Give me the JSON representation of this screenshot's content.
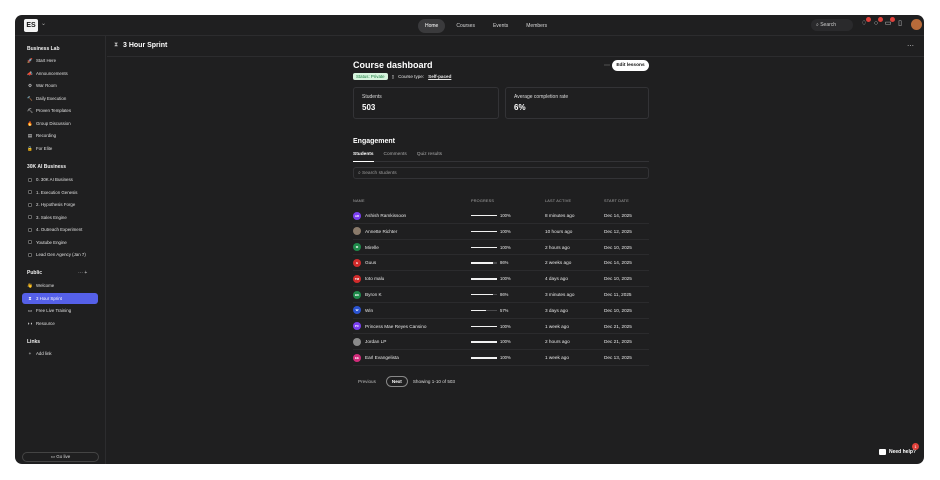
{
  "topbar": {
    "logo": "ES",
    "nav": [
      "Home",
      "Courses",
      "Events",
      "Members"
    ],
    "active_nav": "Home",
    "search_label": "Search",
    "icons": [
      "bell-icon",
      "chat-icon",
      "message-icon",
      "bookmark-icon"
    ]
  },
  "sidebar": {
    "sections": [
      {
        "title": "Business Lab",
        "items": [
          {
            "icon": "🚀",
            "label": "Start Here"
          },
          {
            "icon": "📣",
            "label": "Announcements"
          },
          {
            "icon": "⚙",
            "label": "War Room"
          },
          {
            "icon": "🔨",
            "label": "Daily Execution"
          },
          {
            "icon": "⛏",
            "label": "Proven Templates"
          },
          {
            "icon": "🔥",
            "label": "Group Discussion"
          },
          {
            "icon": "▤",
            "label": "Recording"
          },
          {
            "icon": "🔒",
            "label": "For Elite"
          }
        ]
      },
      {
        "title": "30K AI Business",
        "items": [
          {
            "label": "0. 30K AI Business"
          },
          {
            "label": "1. Execution Genesis"
          },
          {
            "label": "2. Hypothesis Forge"
          },
          {
            "label": "3. Sales Engine"
          },
          {
            "label": "4. Outreach Experiment"
          },
          {
            "label": "Youtube Engine"
          },
          {
            "label": "Lead Gen Agency (Jan 7)"
          }
        ]
      },
      {
        "title": "Public",
        "items": [
          {
            "icon": "👋",
            "label": "Welcome"
          },
          {
            "icon": "⧗",
            "label": "3 Hour Sprint",
            "active": true
          },
          {
            "icon": "▭",
            "label": "Free Live Training"
          },
          {
            "icon": "◗◗",
            "label": "Resource"
          }
        ]
      },
      {
        "title": "Links",
        "items": [
          {
            "icon": "+",
            "label": "Add link"
          }
        ]
      }
    ],
    "go_live": "Go live"
  },
  "header": {
    "title": "3 Hour Sprint"
  },
  "course": {
    "title": "Course dashboard",
    "status": "Status: Private",
    "type_label": "Course type:",
    "type_value": "Self-paced",
    "edit_button": "Edit lessons"
  },
  "stats": {
    "students_label": "Students",
    "students_value": "503",
    "completion_label": "Average completion rate",
    "completion_value": "6%"
  },
  "engagement": {
    "title": "Engagement",
    "tabs": [
      "Students",
      "Comments",
      "Quiz results"
    ],
    "search_placeholder": "Search students",
    "columns": [
      "NAME",
      "PROGRESS",
      "LAST ACTIVE",
      "START DATE"
    ],
    "rows": [
      {
        "initials": "AR",
        "color": "#7a3ef0",
        "name": "Ashish Ramkissoon",
        "progress": 100,
        "progress_text": "100%",
        "last_active": "8 minutes ago",
        "start_date": "Dec 14, 2025"
      },
      {
        "initials": "",
        "color": "#8a7a6a",
        "name": "Annette Richter",
        "progress": 100,
        "progress_text": "100%",
        "last_active": "10 hours ago",
        "start_date": "Dec 12, 2025"
      },
      {
        "initials": "M",
        "color": "#1f8a4a",
        "name": "Mirelle",
        "progress": 100,
        "progress_text": "100%",
        "last_active": "2 hours ago",
        "start_date": "Dec 10, 2025"
      },
      {
        "initials": "G",
        "color": "#d12b2b",
        "name": "Guus",
        "progress": 86,
        "progress_text": "86%",
        "last_active": "2 weeks ago",
        "start_date": "Dec 14, 2025"
      },
      {
        "initials": "TM",
        "color": "#d12b2b",
        "name": "toto malu",
        "progress": 100,
        "progress_text": "100%",
        "last_active": "4 days ago",
        "start_date": "Dec 10, 2025"
      },
      {
        "initials": "BK",
        "color": "#1f8a4a",
        "name": "Byron K",
        "progress": 86,
        "progress_text": "86%",
        "last_active": "3 minutes ago",
        "start_date": "Dec 11, 2025"
      },
      {
        "initials": "W",
        "color": "#2b54d1",
        "name": "Win",
        "progress": 57,
        "progress_text": "57%",
        "last_active": "3 days ago",
        "start_date": "Dec 10, 2025"
      },
      {
        "initials": "PC",
        "color": "#7a3ef0",
        "name": "Princess Mae Reyes Cansino",
        "progress": 100,
        "progress_text": "100%",
        "last_active": "1 week ago",
        "start_date": "Dec 21, 2025"
      },
      {
        "initials": "",
        "color": "#8a8a8a",
        "name": "Jordan LP",
        "progress": 100,
        "progress_text": "100%",
        "last_active": "2 hours ago",
        "start_date": "Dec 21, 2025"
      },
      {
        "initials": "EE",
        "color": "#d12b7a",
        "name": "Earl Evangelista",
        "progress": 100,
        "progress_text": "100%",
        "last_active": "1 week ago",
        "start_date": "Dec 13, 2025"
      }
    ]
  },
  "pager": {
    "prev": "Previous",
    "next": "Next",
    "info": "Showing 1-10 of 503"
  },
  "help": {
    "label": "Need help?",
    "badge": "1"
  }
}
